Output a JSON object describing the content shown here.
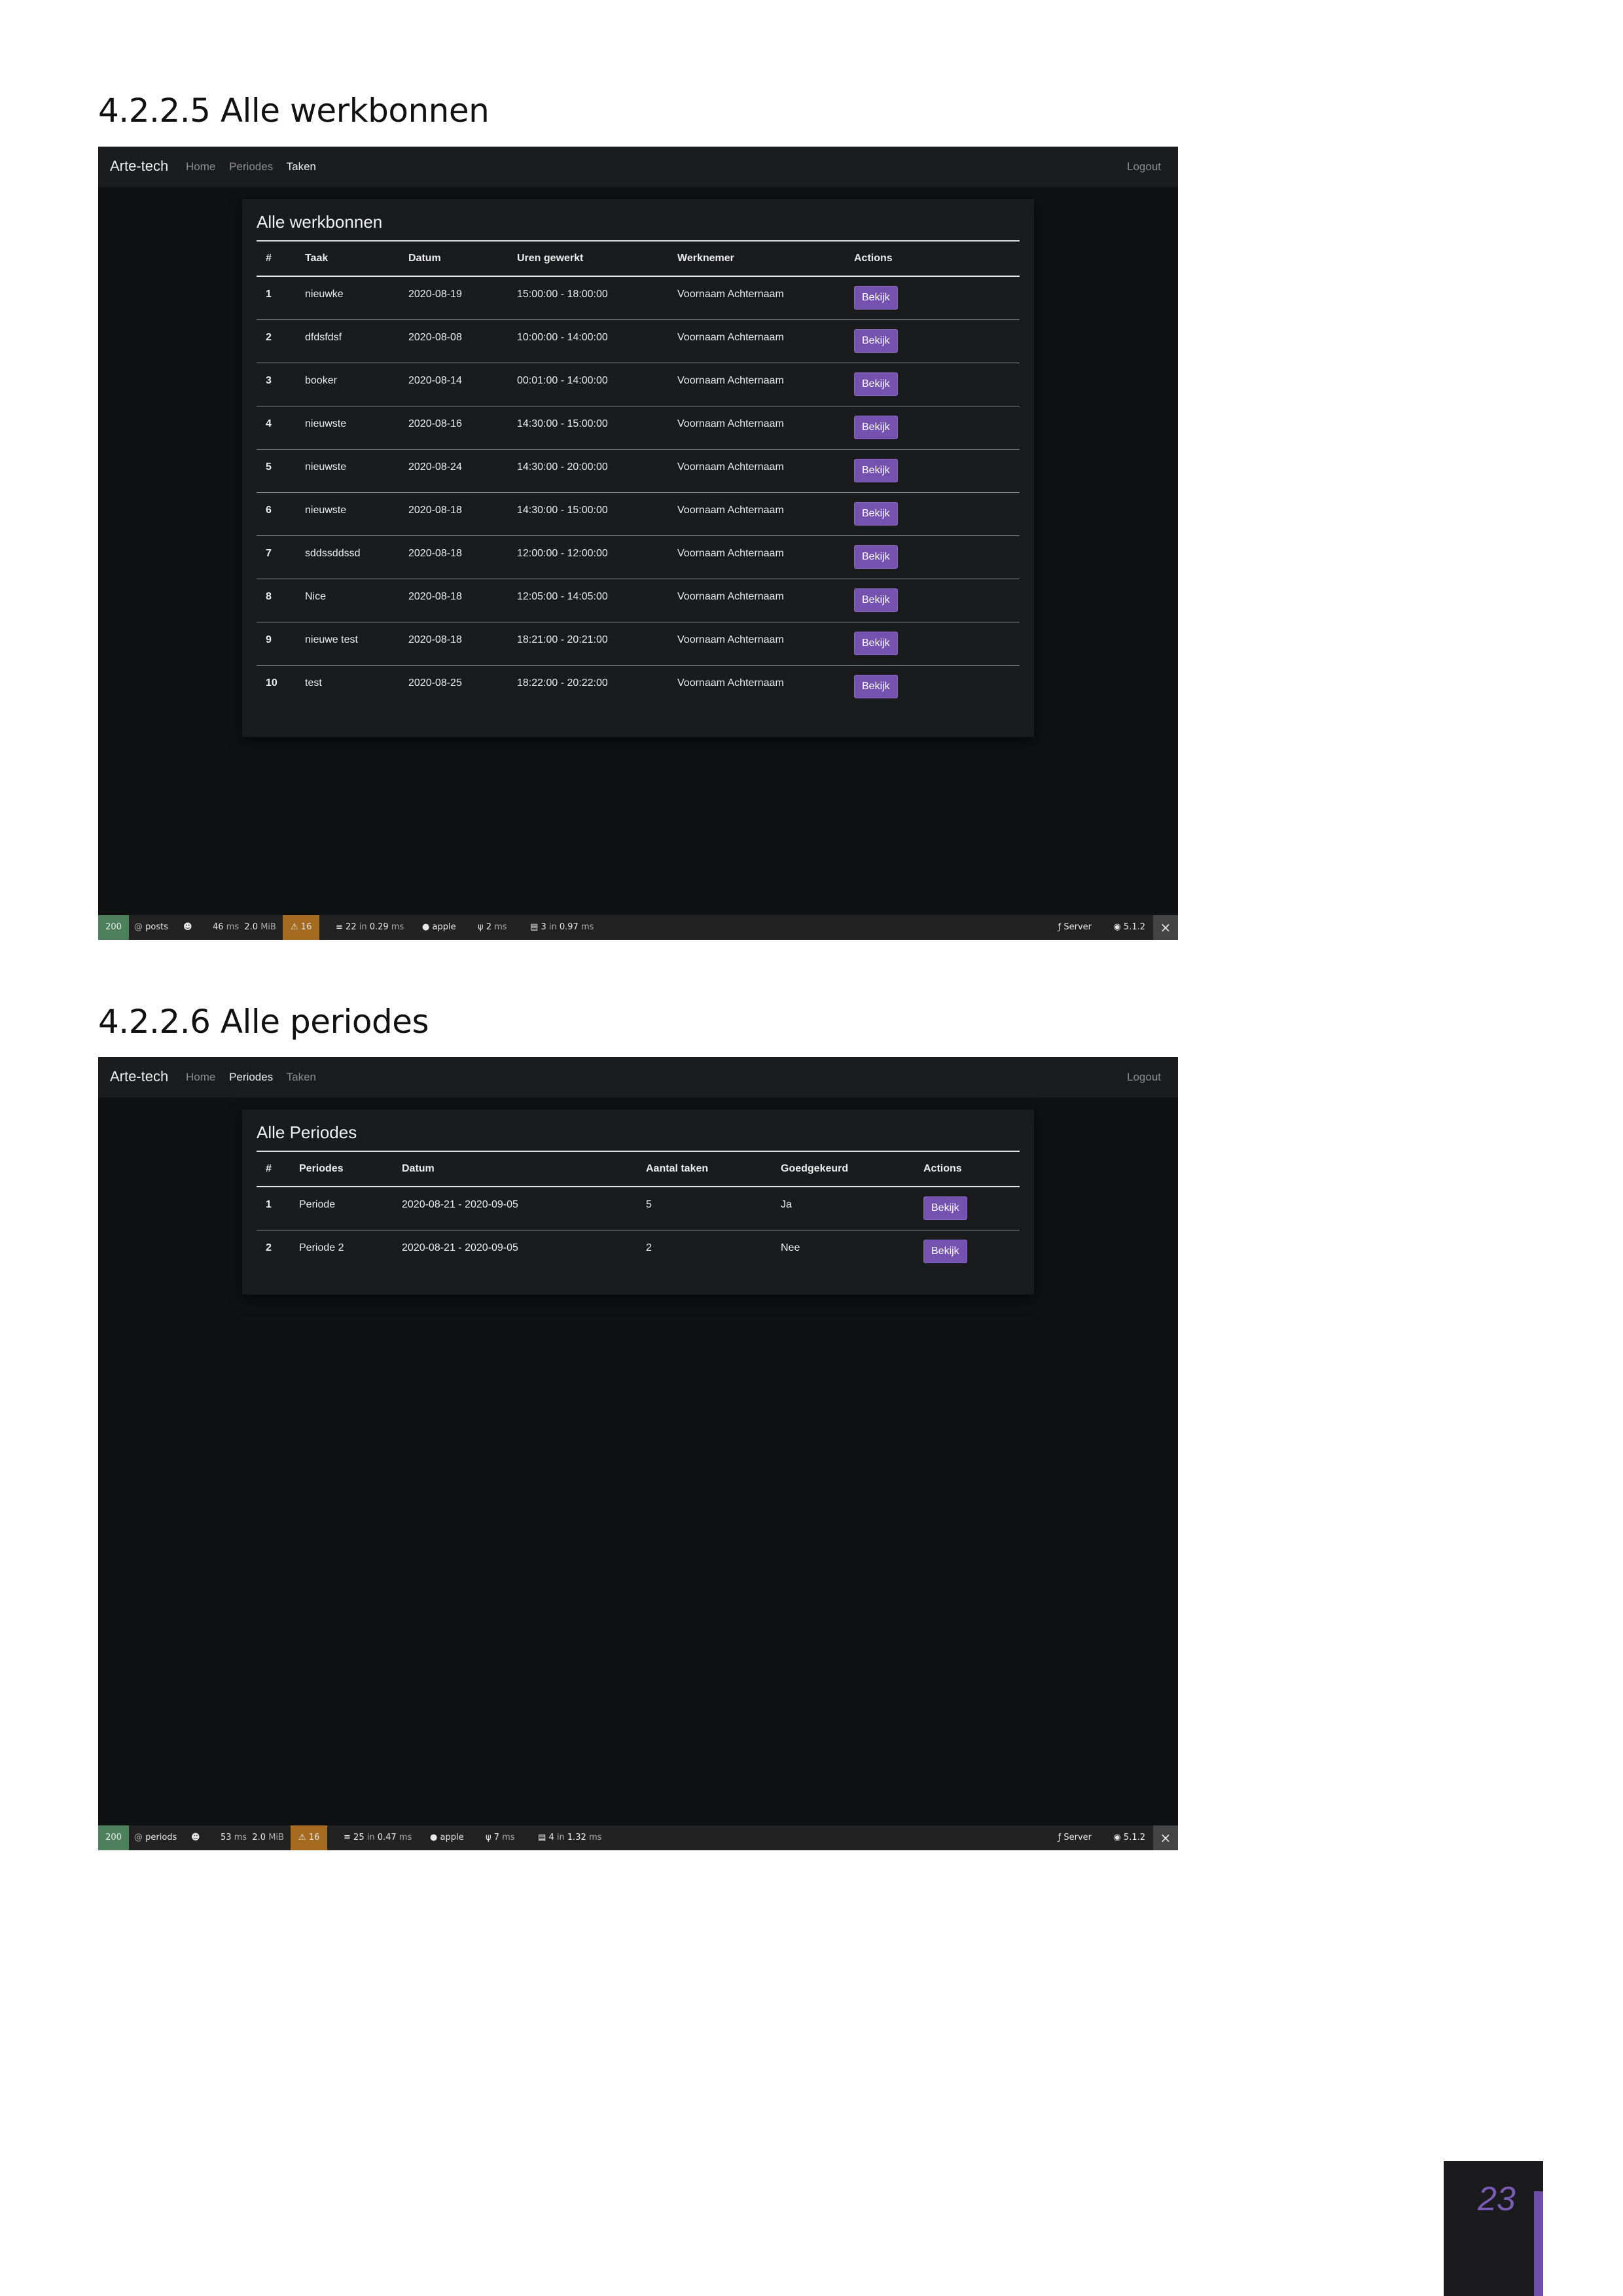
{
  "sections": [
    {
      "heading": "4.2.2.5 Alle werkbonnen",
      "app": {
        "brand": "Arte-tech",
        "nav": [
          "Home",
          "Periodes",
          "Taken"
        ],
        "active_nav": "Taken",
        "logout": "Logout"
      },
      "card_title": "Alle werkbonnen",
      "columns": [
        "#",
        "Taak",
        "Datum",
        "Uren gewerkt",
        "Werknemer",
        "Actions"
      ],
      "rows": [
        [
          "1",
          "nieuwke",
          "2020-08-19",
          "15:00:00 - 18:00:00",
          "Voornaam Achternaam",
          "Bekijk"
        ],
        [
          "2",
          "dfdsfdsf",
          "2020-08-08",
          "10:00:00 - 14:00:00",
          "Voornaam Achternaam",
          "Bekijk"
        ],
        [
          "3",
          "booker",
          "2020-08-14",
          "00:01:00 - 14:00:00",
          "Voornaam Achternaam",
          "Bekijk"
        ],
        [
          "4",
          "nieuwste",
          "2020-08-16",
          "14:30:00 - 15:00:00",
          "Voornaam Achternaam",
          "Bekijk"
        ],
        [
          "5",
          "nieuwste",
          "2020-08-24",
          "14:30:00 - 20:00:00",
          "Voornaam Achternaam",
          "Bekijk"
        ],
        [
          "6",
          "nieuwste",
          "2020-08-18",
          "14:30:00 - 15:00:00",
          "Voornaam Achternaam",
          "Bekijk"
        ],
        [
          "7",
          "sddssddssd",
          "2020-08-18",
          "12:00:00 - 12:00:00",
          "Voornaam Achternaam",
          "Bekijk"
        ],
        [
          "8",
          "Nice",
          "2020-08-18",
          "12:05:00 - 14:05:00",
          "Voornaam Achternaam",
          "Bekijk"
        ],
        [
          "9",
          "nieuwe test",
          "2020-08-18",
          "18:21:00 - 20:21:00",
          "Voornaam Achternaam",
          "Bekijk"
        ],
        [
          "10",
          "test",
          "2020-08-25",
          "18:22:00 - 20:22:00",
          "Voornaam Achternaam",
          "Bekijk"
        ]
      ],
      "toolbar": {
        "status": "200",
        "route": "posts",
        "time": "46",
        "time_unit": "ms",
        "memory": "2.0",
        "memory_unit": "MiB",
        "warnings": "16",
        "db": "22",
        "db_in": "in",
        "db_time": "0.29",
        "db_unit": "ms",
        "user": "apple",
        "twig": "2",
        "twig_unit": "ms",
        "cache": "3",
        "cache_in": "in",
        "cache_time": "0.97",
        "cache_unit": "ms",
        "server": "Server",
        "version": "5.1.2",
        "close_icon": "close-icon"
      }
    },
    {
      "heading": "4.2.2.6 Alle periodes",
      "app": {
        "brand": "Arte-tech",
        "nav": [
          "Home",
          "Periodes",
          "Taken"
        ],
        "active_nav": "Periodes",
        "logout": "Logout"
      },
      "card_title": "Alle Periodes",
      "columns": [
        "#",
        "Periodes",
        "Datum",
        "Aantal taken",
        "Goedgekeurd",
        "Actions"
      ],
      "rows": [
        [
          "1",
          "Periode",
          "2020-08-21 - 2020-09-05",
          "5",
          "Ja",
          "Bekijk"
        ],
        [
          "2",
          "Periode 2",
          "2020-08-21 - 2020-09-05",
          "2",
          "Nee",
          "Bekijk"
        ]
      ],
      "toolbar": {
        "status": "200",
        "route": "periods",
        "time": "53",
        "time_unit": "ms",
        "memory": "2.0",
        "memory_unit": "MiB",
        "warnings": "16",
        "db": "25",
        "db_in": "in",
        "db_time": "0.47",
        "db_unit": "ms",
        "user": "apple",
        "twig": "7",
        "twig_unit": "ms",
        "cache": "4",
        "cache_in": "in",
        "cache_time": "1.32",
        "cache_unit": "ms",
        "server": "Server",
        "version": "5.1.2",
        "close_icon": "close-icon"
      }
    }
  ],
  "page_number": "23",
  "colors": {
    "accent": "#7552b0",
    "background": "#101113",
    "status_ok": "#4f805d",
    "warning": "#a46a1f"
  }
}
